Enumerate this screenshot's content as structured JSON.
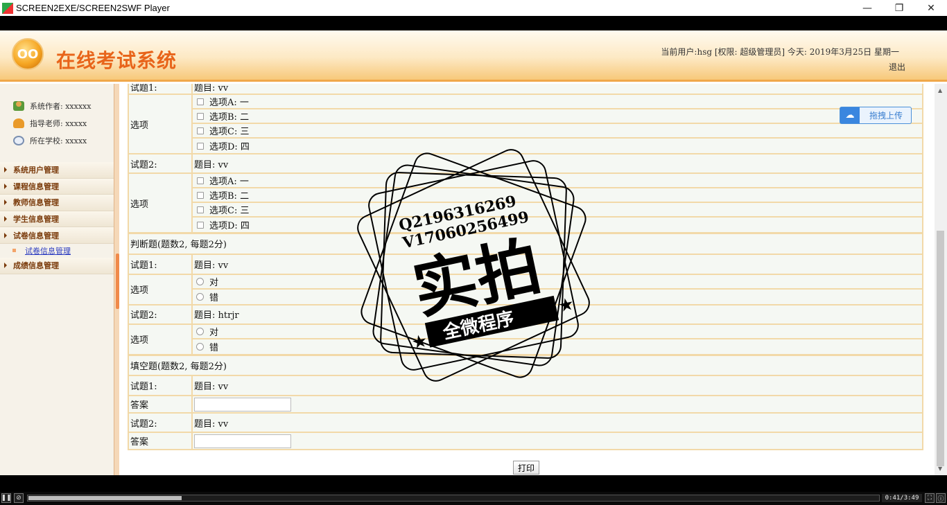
{
  "window": {
    "title": "SCREEN2EXE/SCREEN2SWF Player",
    "controls": [
      "—",
      "❐",
      "✕"
    ]
  },
  "header": {
    "logo_text": "OO",
    "system_title": "在线考试系统",
    "user_info": "当前用户:hsg [权限: 超级管理员] 今天: 2019年3月25日 星期一",
    "logout": "退出"
  },
  "sidebar": {
    "info": [
      {
        "icon": "user-icon",
        "text": "系统作者: xxxxxx"
      },
      {
        "icon": "teacher-icon",
        "text": "指导老师: xxxxx"
      },
      {
        "icon": "school-icon",
        "text": "所在学校: xxxxx"
      }
    ],
    "menu": [
      {
        "label": "系统用户管理"
      },
      {
        "label": "课程信息管理"
      },
      {
        "label": "教师信息管理"
      },
      {
        "label": "学生信息管理"
      },
      {
        "label": "试卷信息管理"
      }
    ],
    "submenu": {
      "label": "试卷信息管理"
    },
    "menu_after": {
      "label": "成绩信息管理"
    }
  },
  "exam": {
    "choice_partial_label": "试题1:",
    "choice_partial_question": "题目: vv",
    "options_label": "选项",
    "choice_q1_options": [
      "选项A: 一",
      "选项B: 二",
      "选项C: 三",
      "选项D: 四"
    ],
    "choice_q2_label": "试题2:",
    "choice_q2_question": "题目: vv",
    "choice_q2_options": [
      "选项A: 一",
      "选项B: 二",
      "选项C: 三",
      "选项D: 四"
    ],
    "judge_heading": "判断题(题数2, 每题2分)",
    "judge_q1_label": "试题1:",
    "judge_q1_question": "题目: vv",
    "judge_q1_options": [
      "对",
      "错"
    ],
    "judge_q2_label": "试题2:",
    "judge_q2_question": "题目: htrjr",
    "judge_q2_options": [
      "对",
      "错"
    ],
    "fill_heading": "填空题(题数2, 每题2分)",
    "fill_q1_label": "试题1:",
    "fill_q1_question": "题目: vv",
    "answer_label": "答案",
    "fill_q1_answer": "",
    "fill_q2_label": "试题2:",
    "fill_q2_question": "题目: vv",
    "fill_q2_answer": "",
    "print_button": "打印"
  },
  "upload": {
    "label": "拖拽上传"
  },
  "watermark": {
    "line1": "Q2196316269",
    "line2": "V17060256499",
    "main": "实拍",
    "banner": "全微程序"
  },
  "player": {
    "time": "0:41/3:49",
    "progress_fraction": 0.18
  }
}
